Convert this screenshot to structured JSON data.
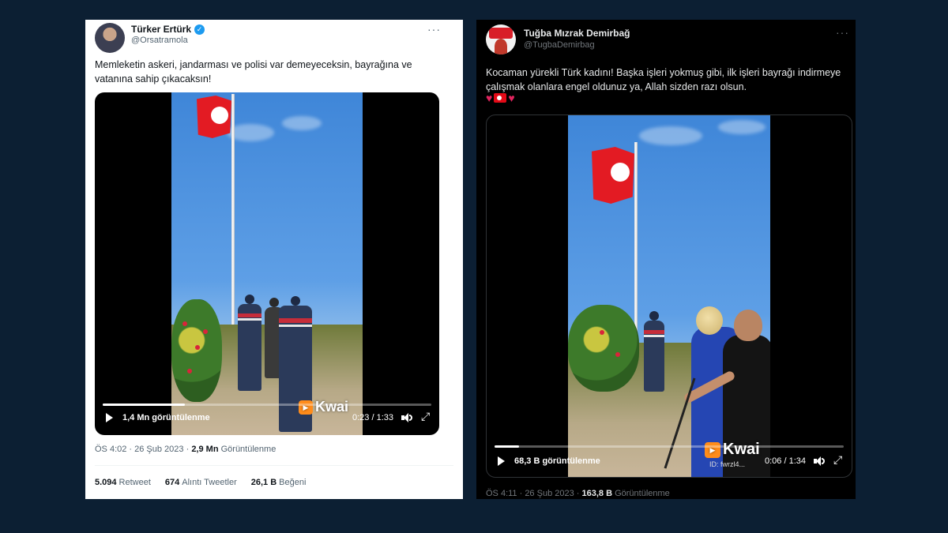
{
  "tweets": [
    {
      "theme": "light",
      "author": {
        "name": "Türker Ertürk",
        "handle": "@Orsatramola",
        "verified": true
      },
      "more_label": "···",
      "text": "Memleketin askeri, jandarması ve polisi var demeyeceksin, bayrağına ve vatanına sahip çıkacaksın!",
      "video": {
        "views": "1,4 Mn görüntülenme",
        "time": "0:23 / 1:33",
        "progress": 0.25,
        "watermark": "Kwai"
      },
      "meta": {
        "time": "ÖS 4:02 · 26 Şub 2023 · ",
        "views_count": "2,9 Mn",
        "views_label": " Görüntülenme"
      },
      "stats": [
        {
          "count": "5.094",
          "label": "Retweet"
        },
        {
          "count": "674",
          "label": "Alıntı Tweetler"
        },
        {
          "count": "26,1 B",
          "label": "Beğeni"
        }
      ]
    },
    {
      "theme": "dark",
      "author": {
        "name": "Tuğba Mızrak Demirbağ",
        "handle": "@TugbaDemirbag",
        "verified": false
      },
      "more_label": "···",
      "text": "Kocaman yürekli Türk kadını! Başka işleri yokmuş gibi, ilk işleri bayrağı indirmeye çalışmak olanlara engel oldunuz ya, Allah sizden razı olsun.",
      "emojis": [
        "red-heart-icon",
        "turkey-flag-icon",
        "red-heart-icon"
      ],
      "video": {
        "views": "68,3 B görüntülenme",
        "time": "0:06 / 1:34",
        "progress": 0.07,
        "watermark": "Kwai",
        "watermark_id": "ID: fwrzl4..."
      },
      "meta": {
        "time": "ÖS 4:11 · 26 Şub 2023 · ",
        "views_count": "163,8 B",
        "views_label": " Görüntülenme"
      }
    }
  ],
  "colors": {
    "page_bg": "#0c1f33",
    "verified": "#1d9bf0",
    "flag_red": "#e31b23",
    "heart": "#e0245e"
  }
}
